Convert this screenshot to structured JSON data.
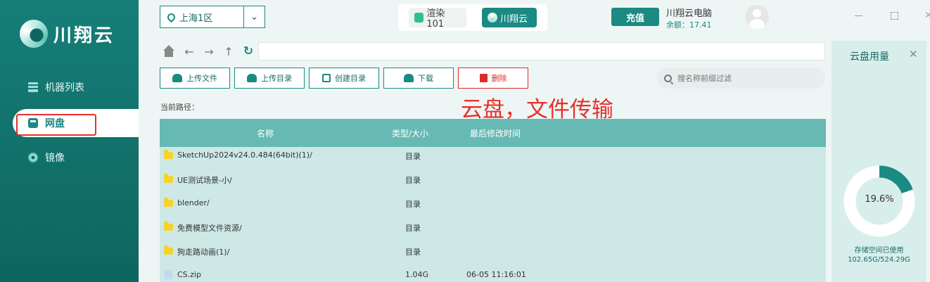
{
  "app": {
    "logo_text": "川翔云"
  },
  "sidebar": {
    "items": [
      {
        "label": "机器列表",
        "icon": "list-icon"
      },
      {
        "label": "网盘",
        "icon": "disk-icon",
        "active": true
      },
      {
        "label": "镜像",
        "icon": "mirror-icon"
      }
    ]
  },
  "header": {
    "region": "上海1区",
    "switch_tabs": [
      {
        "label": "渲染101"
      },
      {
        "label": "川翔云",
        "active": true
      }
    ],
    "recharge_label": "充值",
    "user_name": "川翔云电脑",
    "balance": "余额：17.41"
  },
  "toolbar": {
    "upload_file": "上传文件",
    "upload_dir": "上传目录",
    "create_dir": "创建目录",
    "download": "下载",
    "delete": "删除",
    "search_placeholder": "搜名称前缀过滤",
    "path_value": ""
  },
  "current_path_label": "当前路径：",
  "annotation": "云盘，文件传输",
  "table": {
    "columns": [
      "名称",
      "类型/大小",
      "最后修改时间"
    ],
    "rows": [
      {
        "name": "SketchUp2024v24.0.484(64bit)(1)/",
        "type": "目录",
        "time": "",
        "kind": "folder"
      },
      {
        "name": "UE测试场景-小/",
        "type": "目录",
        "time": "",
        "kind": "folder"
      },
      {
        "name": "blender/",
        "type": "目录",
        "time": "",
        "kind": "folder"
      },
      {
        "name": "免费模型文件资源/",
        "type": "目录",
        "time": "",
        "kind": "folder"
      },
      {
        "name": "狗走路动画(1)/",
        "type": "目录",
        "time": "",
        "kind": "folder"
      },
      {
        "name": "CS.zip",
        "type": "1.04G",
        "time": "06-05 11:16:01",
        "kind": "file"
      }
    ]
  },
  "storage": {
    "title": "云盘用量",
    "percent_label": "19.6%",
    "used_fraction": 0.196,
    "caption": "存储空间已使用",
    "value": "102.65G/524.29G",
    "colors": {
      "used": "#1a8a82",
      "free": "#ffffff"
    }
  }
}
